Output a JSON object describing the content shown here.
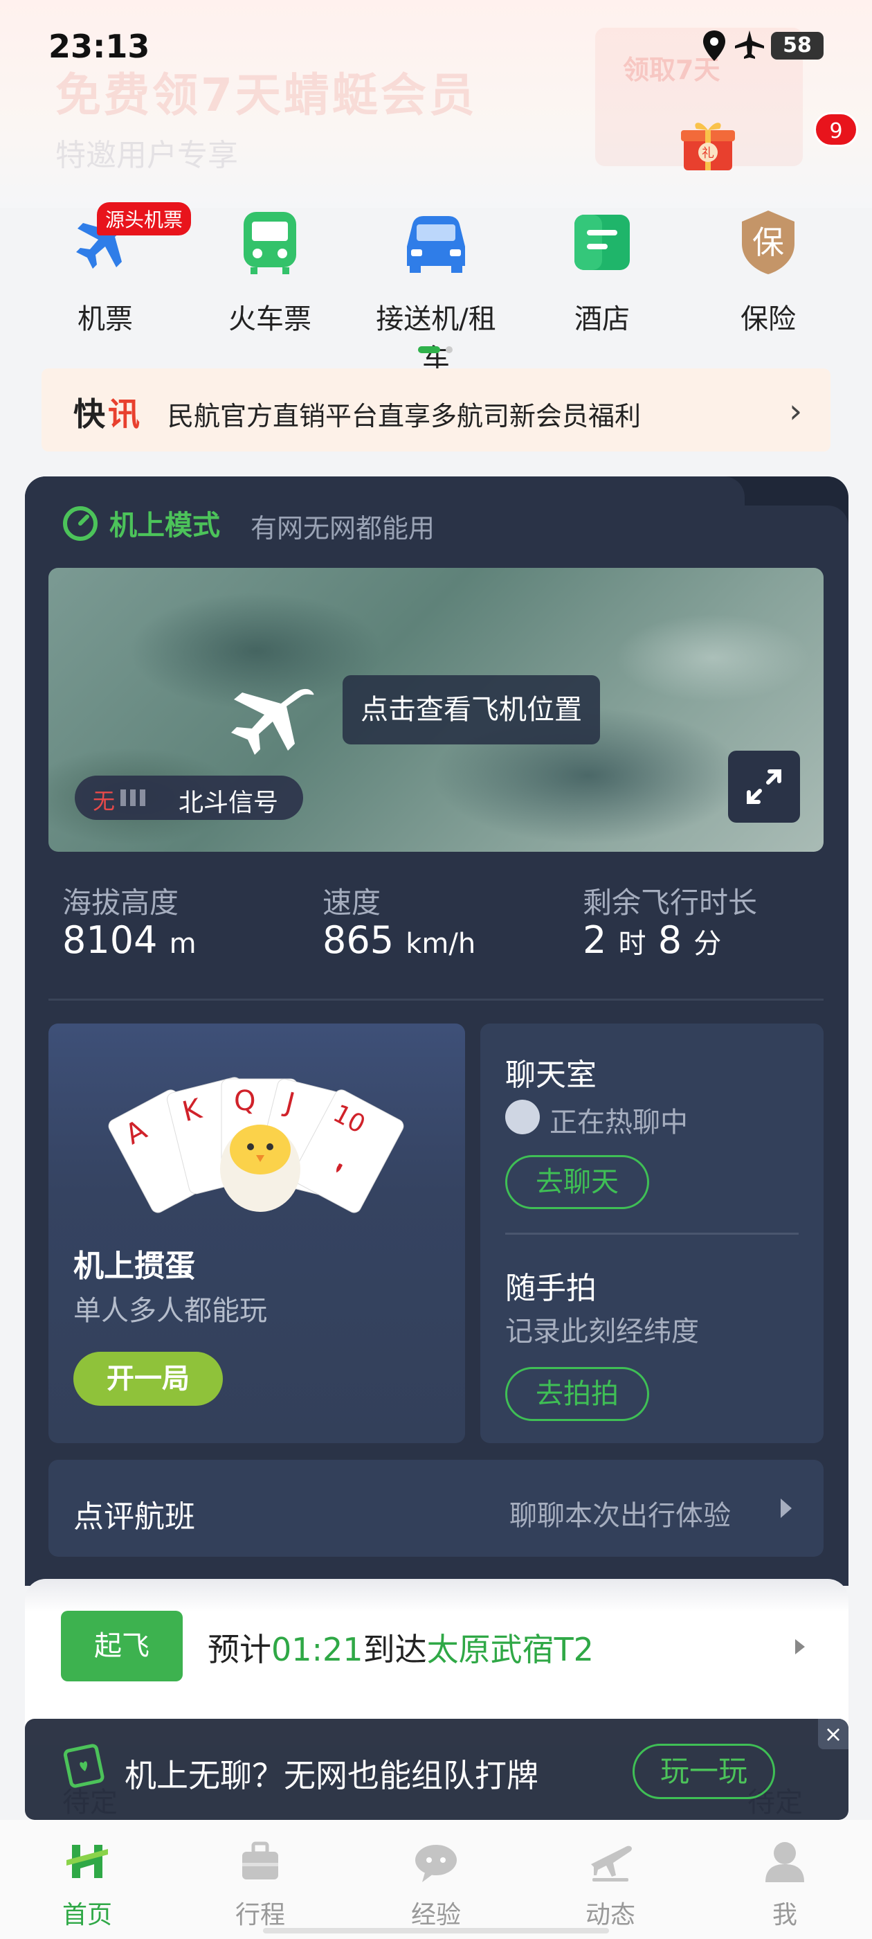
{
  "status_bar": {
    "time": "23:13",
    "battery": "58"
  },
  "promo": {
    "title": "免费领7天蜻蜓会员",
    "subtitle": "特邀用户专享",
    "card_label": "领取7天"
  },
  "notification_badge": "9",
  "services": [
    {
      "label": "机票",
      "icon": "plane-icon",
      "tag": "源头机票"
    },
    {
      "label": "火车票",
      "icon": "train-icon"
    },
    {
      "label": "接送机/租车",
      "icon": "car-icon"
    },
    {
      "label": "酒店",
      "icon": "hotel-icon"
    },
    {
      "label": "保险",
      "icon": "insurance-icon",
      "glyph": "保"
    }
  ],
  "news": {
    "kuai": "快",
    "xun": "讯",
    "text": "民航官方直销平台直享多航司新会员福利"
  },
  "flight_mode": {
    "title": "机上模式",
    "subtitle": "有网无网都能用",
    "map_tip": "点击查看飞机位置",
    "signal_status": "无",
    "signal_label": "北斗信号"
  },
  "stats": {
    "altitude": {
      "label": "海拔高度",
      "value": "8104",
      "unit": "m"
    },
    "speed": {
      "label": "速度",
      "value": "865",
      "unit": "km/h"
    },
    "remaining": {
      "label": "剩余飞行时长",
      "hours": "2",
      "hours_unit": "时",
      "minutes": "8",
      "minutes_unit": "分"
    }
  },
  "game": {
    "title": "机上掼蛋",
    "subtitle": "单人多人都能玩",
    "button": "开一局",
    "cards": [
      "A",
      "K",
      "Q",
      "J",
      "10"
    ]
  },
  "chat": {
    "title": "聊天室",
    "subtitle": "正在热聊中",
    "button": "去聊天"
  },
  "snap": {
    "title": "随手拍",
    "subtitle": "记录此刻经纬度",
    "button": "去拍拍"
  },
  "review": {
    "title": "点评航班",
    "hint": "聊聊本次出行体验"
  },
  "flight_status": {
    "status": "起飞",
    "eta_prefix": "预计",
    "eta_time": "01:21",
    "eta_middle": "到达",
    "destination": "太原武宿T2",
    "left_bottom": "待定",
    "right_bottom": "待定"
  },
  "toast": {
    "text": "机上无聊？无网也能组队打牌",
    "button": "玩一玩",
    "close": "×"
  },
  "nav": [
    {
      "label": "首页",
      "icon": "home-icon",
      "active": true
    },
    {
      "label": "行程",
      "icon": "suitcase-icon"
    },
    {
      "label": "经验",
      "icon": "chat-bubble-icon"
    },
    {
      "label": "动态",
      "icon": "flight-status-icon"
    },
    {
      "label": "我",
      "icon": "profile-icon"
    }
  ],
  "colors": {
    "accent": "#2fa846",
    "panel": "#2a3347",
    "alert": "#e8141c"
  }
}
